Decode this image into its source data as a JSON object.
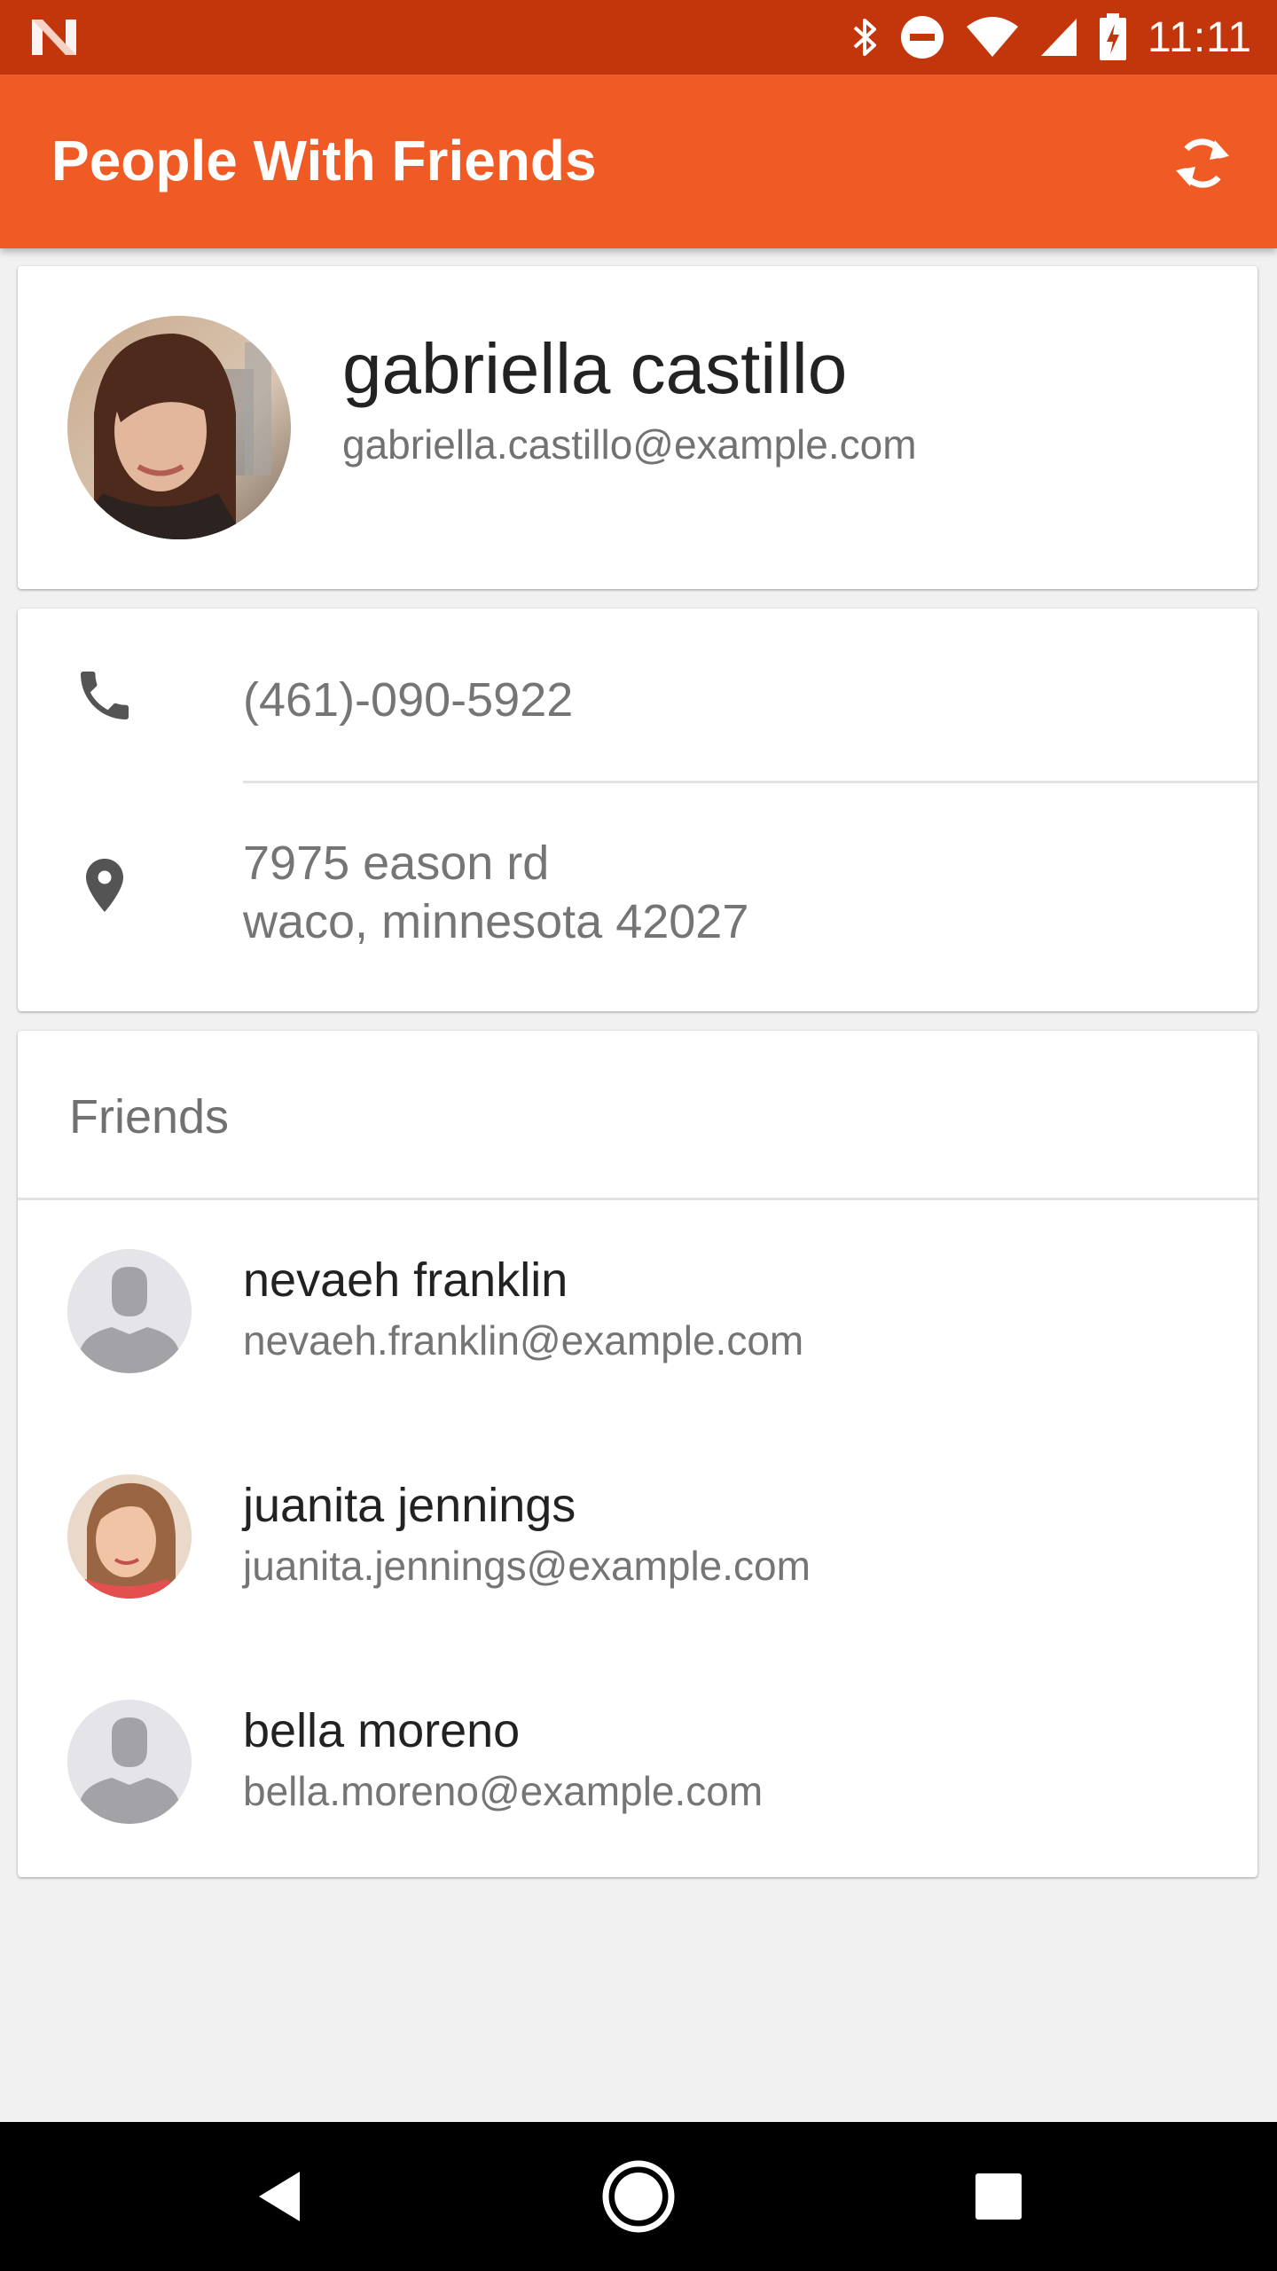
{
  "status_bar": {
    "time": "11:11",
    "icons": [
      "notification-n-icon",
      "bluetooth-icon",
      "do-not-disturb-icon",
      "wifi-icon",
      "signal-icon",
      "battery-charging-icon"
    ]
  },
  "app_bar": {
    "title": "People With Friends",
    "action_icon": "refresh-icon",
    "color": "#f05a24",
    "status_color": "#c3360c"
  },
  "profile": {
    "name": "gabriella castillo",
    "email": "gabriella.castillo@example.com",
    "avatar": "photo"
  },
  "contact": {
    "phone": "(461)-090-5922",
    "address_line1": "7975 eason rd",
    "address_line2": "waco, minnesota 42027",
    "phone_icon": "phone-icon",
    "address_icon": "location-pin-icon"
  },
  "friends": {
    "header": "Friends",
    "items": [
      {
        "name": "nevaeh franklin",
        "email": "nevaeh.franklin@example.com",
        "avatar": "placeholder"
      },
      {
        "name": "juanita jennings",
        "email": "juanita.jennings@example.com",
        "avatar": "photo"
      },
      {
        "name": "bella moreno",
        "email": "bella.moreno@example.com",
        "avatar": "placeholder"
      }
    ]
  },
  "nav_bar": {
    "buttons": [
      "back-icon",
      "home-icon",
      "recents-icon"
    ]
  }
}
